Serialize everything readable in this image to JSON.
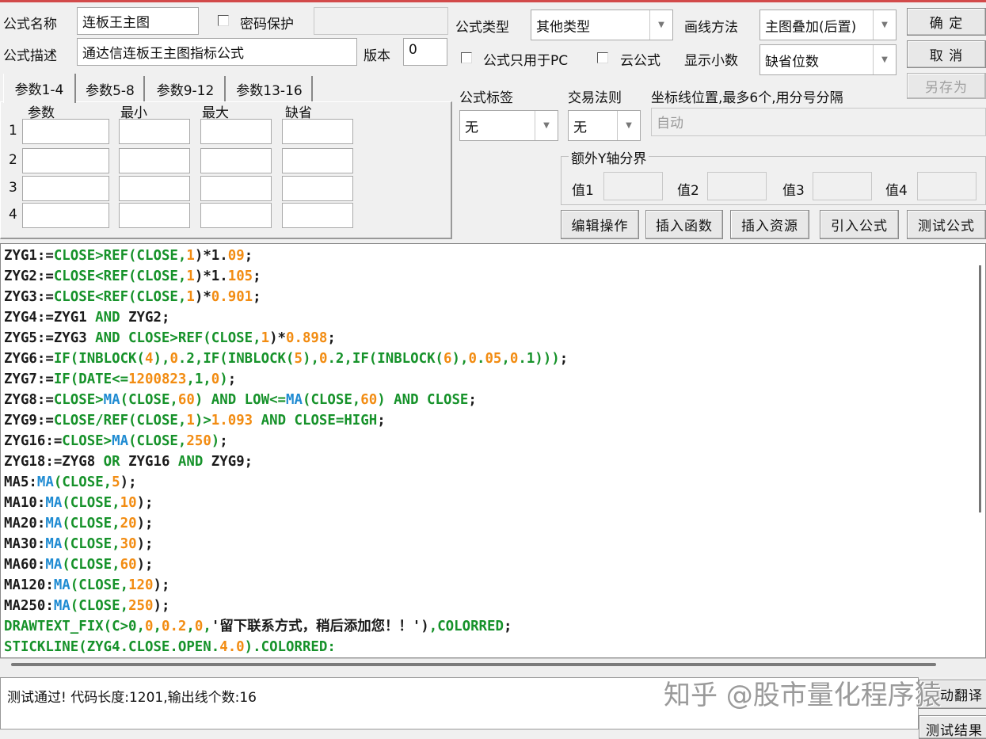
{
  "form": {
    "name_label": "公式名称",
    "name_value": "连板王主图",
    "password_label": "密码保护",
    "password_value": "",
    "desc_label": "公式描述",
    "desc_value": "通达信连板王主图指标公式",
    "version_label": "版本",
    "version_value": "0",
    "type_label": "公式类型",
    "type_value": "其他类型",
    "draw_label": "画线方法",
    "draw_value": "主图叠加(后置)",
    "pc_only_label": "公式只用于PC",
    "cloud_label": "云公式",
    "decimal_label": "显示小数",
    "decimal_value": "缺省位数",
    "tag_label": "公式标签",
    "tag_value": "无",
    "rule_label": "交易法则",
    "rule_value": "无",
    "axis_label": "坐标线位置,最多6个,用分号分隔",
    "axis_value": "自动",
    "yaxis_group_label": "额外Y轴分界",
    "yaxis_values": [
      {
        "label": "值1",
        "value": ""
      },
      {
        "label": "值2",
        "value": ""
      },
      {
        "label": "值3",
        "value": ""
      },
      {
        "label": "值4",
        "value": ""
      }
    ]
  },
  "buttons": {
    "ok": "确  定",
    "cancel": "取  消",
    "save_as": "另存为",
    "edit_ops": "编辑操作",
    "insert_func": "插入函数",
    "insert_res": "插入资源",
    "import_formula": "引入公式",
    "test_formula": "测试公式",
    "translate": "动翻译",
    "test_result": "测试结果"
  },
  "params": {
    "tabs": [
      "参数1-4",
      "参数5-8",
      "参数9-12",
      "参数13-16"
    ],
    "active_tab": 0,
    "headers": [
      "参数",
      "最小",
      "最大",
      "缺省"
    ],
    "rows": [
      "1",
      "2",
      "3",
      "4"
    ]
  },
  "code_lines": [
    [
      [
        "d",
        "ZYG1:="
      ],
      [
        "g",
        "CLOSE>REF(CLOSE,"
      ],
      [
        "o",
        "1"
      ],
      [
        "d",
        ")*1."
      ],
      [
        "o",
        "09"
      ],
      [
        "d",
        ";"
      ]
    ],
    [
      [
        "d",
        "ZYG2:="
      ],
      [
        "g",
        "CLOSE<REF(CLOSE,"
      ],
      [
        "o",
        "1"
      ],
      [
        "d",
        ")*1."
      ],
      [
        "o",
        "105"
      ],
      [
        "d",
        ";"
      ]
    ],
    [
      [
        "d",
        "ZYG3:="
      ],
      [
        "g",
        "CLOSE<REF(CLOSE,"
      ],
      [
        "o",
        "1"
      ],
      [
        "d",
        ")*"
      ],
      [
        "o",
        "0.901"
      ],
      [
        "d",
        ";"
      ]
    ],
    [
      [
        "d",
        "ZYG4:=ZYG1 "
      ],
      [
        "g",
        "AND"
      ],
      [
        "d",
        " ZYG2;"
      ]
    ],
    [
      [
        "d",
        "ZYG5:=ZYG3 "
      ],
      [
        "g",
        "AND CLOSE>REF(CLOSE,"
      ],
      [
        "o",
        "1"
      ],
      [
        "d",
        ")*"
      ],
      [
        "o",
        "0.898"
      ],
      [
        "d",
        ";"
      ]
    ],
    [
      [
        "d",
        "ZYG6:="
      ],
      [
        "g",
        "IF(INBLOCK("
      ],
      [
        "o",
        "4"
      ],
      [
        "g",
        "),"
      ],
      [
        "o",
        "0"
      ],
      [
        "g",
        ".2,IF(INBLOCK("
      ],
      [
        "o",
        "5"
      ],
      [
        "g",
        "),"
      ],
      [
        "o",
        "0"
      ],
      [
        "g",
        ".2,IF(INBLOCK("
      ],
      [
        "o",
        "6"
      ],
      [
        "g",
        "),"
      ],
      [
        "o",
        "0"
      ],
      [
        "g",
        "."
      ],
      [
        "o",
        "05"
      ],
      [
        "g",
        ","
      ],
      [
        "o",
        "0"
      ],
      [
        "g",
        ".1)))"
      ],
      [
        "d",
        ";"
      ]
    ],
    [
      [
        "d",
        "ZYG7:="
      ],
      [
        "g",
        "IF(DATE<="
      ],
      [
        "o",
        "1200823"
      ],
      [
        "g",
        ",1,"
      ],
      [
        "o",
        "0"
      ],
      [
        "g",
        ")"
      ],
      [
        "d",
        ";"
      ]
    ],
    [
      [
        "d",
        "ZYG8:="
      ],
      [
        "g",
        "CLOSE>"
      ],
      [
        "b",
        "MA"
      ],
      [
        "g",
        "(CLOSE,"
      ],
      [
        "o",
        "60"
      ],
      [
        "g",
        ") AND LOW<="
      ],
      [
        "b",
        "MA"
      ],
      [
        "g",
        "(CLOSE,"
      ],
      [
        "o",
        "60"
      ],
      [
        "g",
        ") AND CLOSE"
      ],
      [
        "d",
        ";"
      ]
    ],
    [
      [
        "d",
        "ZYG9:="
      ],
      [
        "g",
        "CLOSE/REF(CLOSE,"
      ],
      [
        "o",
        "1"
      ],
      [
        "g",
        ")>"
      ],
      [
        "o",
        "1.093"
      ],
      [
        "g",
        " AND CLOSE=HIGH"
      ],
      [
        "d",
        ";"
      ]
    ],
    [
      [
        "d",
        "ZYG16:="
      ],
      [
        "g",
        "CLOSE>"
      ],
      [
        "b",
        "MA"
      ],
      [
        "g",
        "(CLOSE,"
      ],
      [
        "o",
        "250"
      ],
      [
        "g",
        ")"
      ],
      [
        "d",
        ";"
      ]
    ],
    [
      [
        "d",
        "ZYG18:=ZYG8 "
      ],
      [
        "g",
        "OR"
      ],
      [
        "d",
        " ZYG16 "
      ],
      [
        "g",
        "AND"
      ],
      [
        "d",
        " ZYG9;"
      ]
    ],
    [
      [
        "d",
        "MA5:"
      ],
      [
        "b",
        "MA"
      ],
      [
        "g",
        "(CLOSE,"
      ],
      [
        "o",
        "5"
      ],
      [
        "d",
        ");"
      ]
    ],
    [
      [
        "d",
        "MA10:"
      ],
      [
        "b",
        "MA"
      ],
      [
        "g",
        "(CLOSE,"
      ],
      [
        "o",
        "10"
      ],
      [
        "d",
        ");"
      ]
    ],
    [
      [
        "d",
        "MA20:"
      ],
      [
        "b",
        "MA"
      ],
      [
        "g",
        "(CLOSE,"
      ],
      [
        "o",
        "20"
      ],
      [
        "d",
        ");"
      ]
    ],
    [
      [
        "d",
        "MA30:"
      ],
      [
        "b",
        "MA"
      ],
      [
        "g",
        "(CLOSE,"
      ],
      [
        "o",
        "30"
      ],
      [
        "d",
        ");"
      ]
    ],
    [
      [
        "d",
        "MA60:"
      ],
      [
        "b",
        "MA"
      ],
      [
        "g",
        "(CLOSE,"
      ],
      [
        "o",
        "60"
      ],
      [
        "d",
        ");"
      ]
    ],
    [
      [
        "d",
        "MA120:"
      ],
      [
        "b",
        "MA"
      ],
      [
        "g",
        "(CLOSE,"
      ],
      [
        "o",
        "120"
      ],
      [
        "d",
        ");"
      ]
    ],
    [
      [
        "d",
        "MA250:"
      ],
      [
        "b",
        "MA"
      ],
      [
        "g",
        "(CLOSE,"
      ],
      [
        "o",
        "250"
      ],
      [
        "d",
        ");"
      ]
    ],
    [
      [
        "g",
        "DRAWTEXT_FIX(C>0,"
      ],
      [
        "o",
        "0"
      ],
      [
        "g",
        ","
      ],
      [
        "o",
        "0.2"
      ],
      [
        "g",
        ","
      ],
      [
        "o",
        "0"
      ],
      [
        "g",
        ","
      ],
      [
        "d",
        "'留下联系方式，稍后添加您！！')"
      ],
      [
        "g",
        ",COLORRED"
      ],
      [
        "d",
        ";"
      ]
    ],
    [
      [
        "g",
        "STICKLINE(ZYG4.CLOSE.OPEN."
      ],
      [
        "o",
        "4.0"
      ],
      [
        "g",
        ").COLORRED:"
      ]
    ]
  ],
  "status": {
    "message": "测试通过! 代码长度:1201,输出线个数:16"
  },
  "watermark": "知乎 @股市量化程序猿",
  "colors": {
    "keyword_green": "#16922a",
    "number_orange": "#f28c12",
    "function_blue": "#1f8bd2",
    "title_red": "#d24a4a"
  }
}
